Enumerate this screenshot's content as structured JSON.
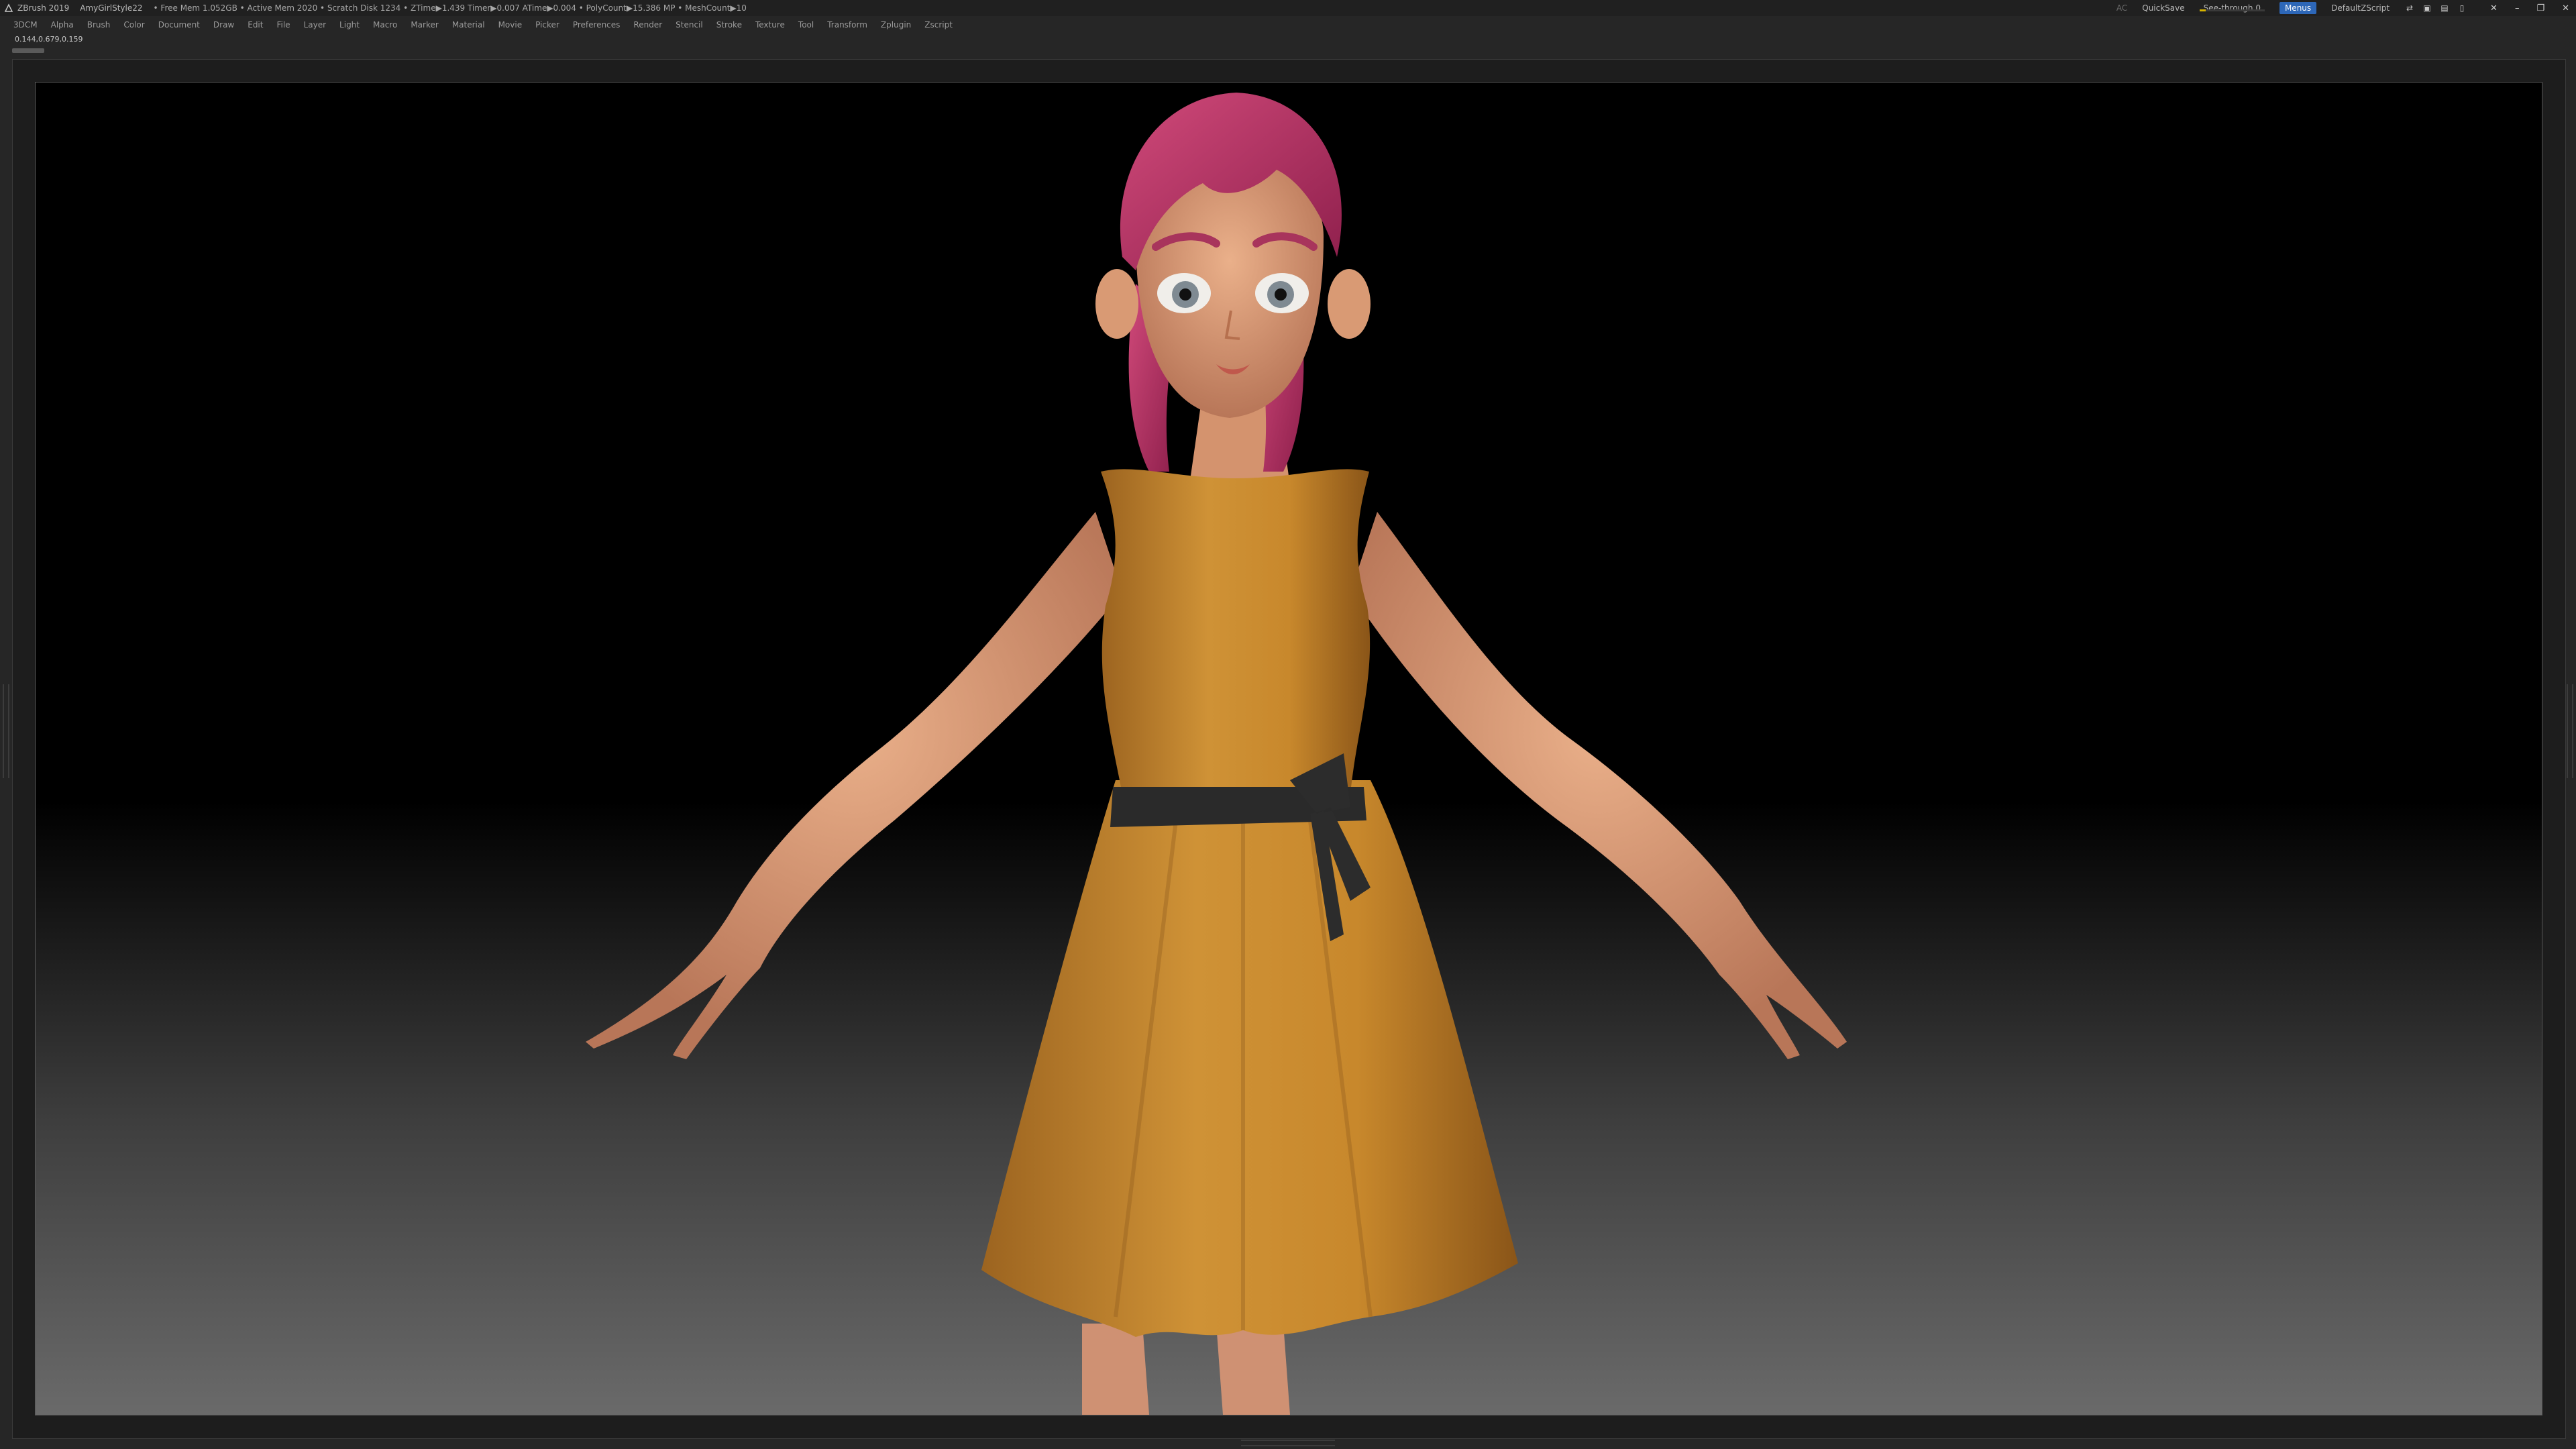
{
  "titlebar": {
    "app_name": "ZBrush 2019",
    "document": "AmyGirlStyle22",
    "stats": "• Free Mem 1.052GB • Active Mem 2020 • Scratch Disk 1234 • ZTime▶1.439 Timer▶0.007 ATime▶0.004 • PolyCount▶15.386 MP • MeshCount▶10",
    "ac_label": "AC",
    "quicksave": "QuickSave",
    "see_through_label": "See-through  0",
    "see_through_value": 0.1,
    "menus_label": "Menus",
    "zscript_label": "DefaultZScript"
  },
  "menubar": {
    "items": [
      "3DCM",
      "Alpha",
      "Brush",
      "Color",
      "Document",
      "Draw",
      "Edit",
      "File",
      "Layer",
      "Light",
      "Macro",
      "Marker",
      "Material",
      "Movie",
      "Picker",
      "Preferences",
      "Render",
      "Stencil",
      "Stroke",
      "Texture",
      "Tool",
      "Transform",
      "Zplugin",
      "Zscript"
    ]
  },
  "coords": "0.144,0.679,0.159",
  "colors": {
    "dress": "#c98a2e",
    "skin": "#e2a47c",
    "hair": "#c23a6a",
    "belt": "#2a2a2a",
    "accent": "#2d67b8"
  }
}
